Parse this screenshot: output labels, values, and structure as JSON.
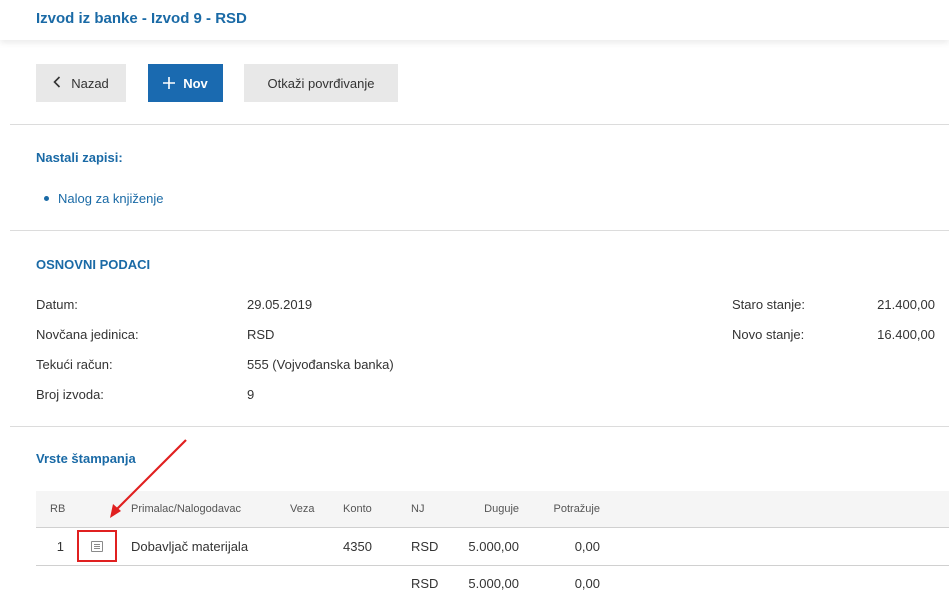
{
  "header": {
    "title": "Izvod iz banke - Izvod 9 - RSD"
  },
  "toolbar": {
    "back_label": "Nazad",
    "back_icon": "chevron-left-icon",
    "new_label": "Nov",
    "new_icon": "plus-icon",
    "cancel_label": "Otkaži povrđivanje"
  },
  "created_records": {
    "title": "Nastali zapisi:",
    "items": [
      {
        "label": "Nalog za knjiženje"
      }
    ]
  },
  "basic_data": {
    "title": "OSNOVNI PODACI",
    "fields": [
      {
        "label": "Datum:",
        "value": "29.05.2019"
      },
      {
        "label": "Novčana jedinica:",
        "value": "RSD"
      },
      {
        "label": "Tekući račun:",
        "value": "555 (Vojvođanska banka)"
      },
      {
        "label": "Broj izvoda:",
        "value": "9"
      }
    ],
    "balances": [
      {
        "label": "Staro stanje:",
        "value": "21.400,00"
      },
      {
        "label": "Novo stanje:",
        "value": "16.400,00"
      }
    ]
  },
  "print_types": {
    "title": "Vrste štampanja",
    "columns": {
      "rb": "RB",
      "partner": "Primalac/Nalogodavac",
      "veza": "Veza",
      "konto": "Konto",
      "nj": "NJ",
      "duguje": "Duguje",
      "potrazuje": "Potražuje"
    },
    "rows": [
      {
        "rb": "1",
        "icon": "document-icon",
        "partner": "Dobavljač materijala",
        "veza": "",
        "konto": "4350",
        "nj": "RSD",
        "duguje": "5.000,00",
        "potrazuje": "0,00"
      }
    ],
    "totals": {
      "nj": "RSD",
      "duguje": "5.000,00",
      "potrazuje": "0,00"
    }
  },
  "colors": {
    "accent": "#1a6aa6",
    "primary_button": "#1a6ab0",
    "secondary_button": "#e8e8e8",
    "highlight": "#e02020"
  }
}
